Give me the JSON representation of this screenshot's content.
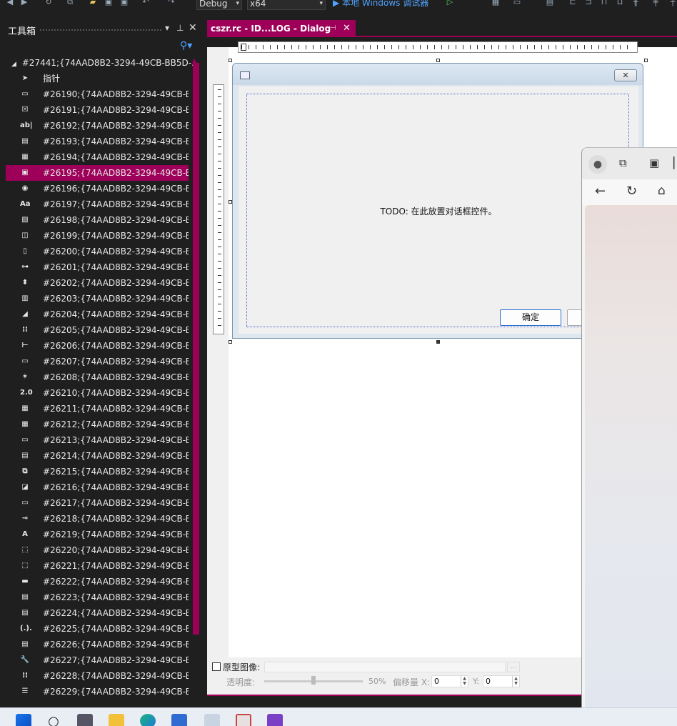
{
  "toolbar": {
    "config": "Debug",
    "platform": "x64",
    "run_label": "▶ 本地 Windows 调试器"
  },
  "toolbox": {
    "title": "工具箱",
    "group": "#27441;{74AAD8B2-3294-49CB-BB5D-...",
    "pointer_label": "指针",
    "items": [
      {
        "label": "#26190;{74AAD8B2-3294-49CB-B...",
        "icon": "button-icon",
        "glyph": "▭"
      },
      {
        "label": "#26191;{74AAD8B2-3294-49CB-B...",
        "icon": "checkbox-icon",
        "glyph": "☒"
      },
      {
        "label": "#26192;{74AAD8B2-3294-49CB-B...",
        "icon": "edit-control-icon",
        "glyph": "ab|"
      },
      {
        "label": "#26193;{74AAD8B2-3294-49CB-B...",
        "icon": "combo-box-icon",
        "glyph": "▤"
      },
      {
        "label": "#26194;{74AAD8B2-3294-49CB-B...",
        "icon": "list-box-icon",
        "glyph": "▦"
      },
      {
        "label": "#26195;{74AAD8B2-3294-49CB-B...",
        "icon": "group-box-icon",
        "glyph": "▣"
      },
      {
        "label": "#26196;{74AAD8B2-3294-49CB-B...",
        "icon": "radio-button-icon",
        "glyph": "◉"
      },
      {
        "label": "#26197;{74AAD8B2-3294-49CB-B...",
        "icon": "static-text-icon",
        "glyph": "Aa"
      },
      {
        "label": "#26198;{74AAD8B2-3294-49CB-B...",
        "icon": "picture-control-icon",
        "glyph": "▨"
      },
      {
        "label": "#26199;{74AAD8B2-3294-49CB-B...",
        "icon": "hscroll-icon",
        "glyph": "◫"
      },
      {
        "label": "#26200;{74AAD8B2-3294-49CB-B...",
        "icon": "vscroll-icon",
        "glyph": "▯"
      },
      {
        "label": "#26201;{74AAD8B2-3294-49CB-B...",
        "icon": "slider-icon",
        "glyph": "⊶"
      },
      {
        "label": "#26202;{74AAD8B2-3294-49CB-B...",
        "icon": "spin-icon",
        "glyph": "⬍"
      },
      {
        "label": "#26203;{74AAD8B2-3294-49CB-B...",
        "icon": "progress-icon",
        "glyph": "▥"
      },
      {
        "label": "#26204;{74AAD8B2-3294-49CB-B...",
        "icon": "hotkey-icon",
        "glyph": "◢"
      },
      {
        "label": "#26205;{74AAD8B2-3294-49CB-B...",
        "icon": "list-control-icon",
        "glyph": "⁝⁝"
      },
      {
        "label": "#26206;{74AAD8B2-3294-49CB-B...",
        "icon": "tree-control-icon",
        "glyph": "⊢"
      },
      {
        "label": "#26207;{74AAD8B2-3294-49CB-B...",
        "icon": "tab-control-icon",
        "glyph": "▭"
      },
      {
        "label": "#26208;{74AAD8B2-3294-49CB-B...",
        "icon": "animation-icon",
        "glyph": "✶"
      },
      {
        "label": "#26210;{74AAD8B2-3294-49CB-B...",
        "icon": "rich-edit-icon",
        "glyph": "2.0"
      },
      {
        "label": "#26211;{74AAD8B2-3294-49CB-B...",
        "icon": "date-time-icon",
        "glyph": "▦"
      },
      {
        "label": "#26212;{74AAD8B2-3294-49CB-B...",
        "icon": "month-calendar-icon",
        "glyph": "▦"
      },
      {
        "label": "#26213;{74AAD8B2-3294-49CB-B...",
        "icon": "ip-address-icon",
        "glyph": "▭"
      },
      {
        "label": "#26214;{74AAD8B2-3294-49CB-B...",
        "icon": "extended-combo-icon",
        "glyph": "▤"
      },
      {
        "label": "#26215;{74AAD8B2-3294-49CB-B...",
        "icon": "custom-control-icon",
        "glyph": "⧉"
      },
      {
        "label": "#26216;{74AAD8B2-3294-49CB-B...",
        "icon": "syslink-icon",
        "glyph": "◪"
      },
      {
        "label": "#26217;{74AAD8B2-3294-49CB-B...",
        "icon": "split-button-icon",
        "glyph": "▭"
      },
      {
        "label": "#26218;{74AAD8B2-3294-49CB-B...",
        "icon": "network-address-icon",
        "glyph": "⊸"
      },
      {
        "label": "#26219;{74AAD8B2-3294-49CB-B...",
        "icon": "font-icon",
        "glyph": "A"
      },
      {
        "label": "#26220;{74AAD8B2-3294-49CB-B...",
        "icon": "command-button-icon",
        "glyph": "⬚"
      },
      {
        "label": "#26221;{74AAD8B2-3294-49CB-B...",
        "icon": "mfc-button-icon",
        "glyph": "⬚"
      },
      {
        "label": "#26222;{74AAD8B2-3294-49CB-B...",
        "icon": "color-button-icon",
        "glyph": "▬"
      },
      {
        "label": "#26223;{74AAD8B2-3294-49CB-B...",
        "icon": "editbrowse-icon",
        "glyph": "▤"
      },
      {
        "label": "#26224;{74AAD8B2-3294-49CB-B...",
        "icon": "vslistbox-icon",
        "glyph": "▤"
      },
      {
        "label": "#26225;{74AAD8B2-3294-49CB-B...",
        "icon": "font-combo-icon",
        "glyph": "(.)."
      },
      {
        "label": "#26226;{74AAD8B2-3294-49CB-B...",
        "icon": "masked-edit-icon",
        "glyph": "▤"
      },
      {
        "label": "#26227;{74AAD8B2-3294-49CB-B...",
        "icon": "wrench-icon",
        "glyph": "🔧"
      },
      {
        "label": "#26228;{74AAD8B2-3294-49CB-B...",
        "icon": "property-grid-icon",
        "glyph": "⁝⁝"
      },
      {
        "label": "#26229;{74AAD8B2-3294-49CB-B...",
        "icon": "shell-list-icon",
        "glyph": "☰"
      }
    ]
  },
  "editor": {
    "tab_label": "cszr.rc - ID...LOG - Dialog",
    "dialog_text": "TODO: 在此放置对话框控件。",
    "ok_label": "确定"
  },
  "props": {
    "prototype_label": "原型图像:",
    "opacity_label": "透明度:",
    "opacity_value": "50%",
    "opacity_level": 0.5,
    "offset_label": "偏移量 X:",
    "x_value": "0",
    "y_label": "Y:",
    "y_value": "0"
  },
  "colors": {
    "accent": "#9e0059",
    "background": "#1f1f1f"
  }
}
